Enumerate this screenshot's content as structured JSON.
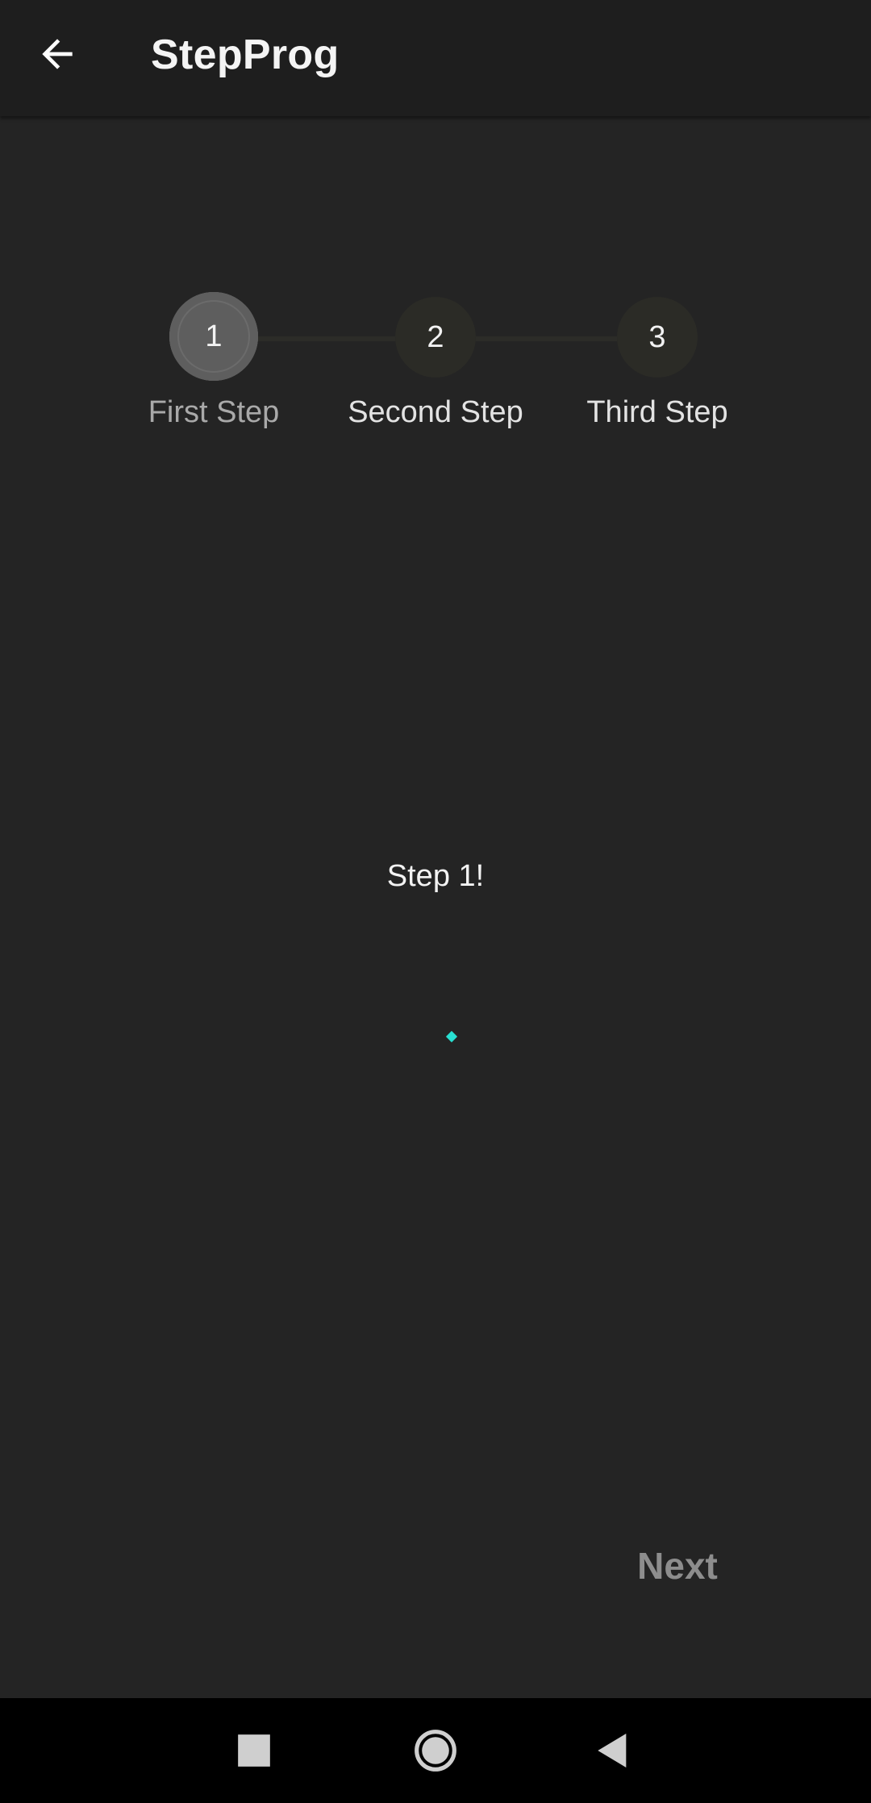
{
  "app_bar": {
    "title": "StepProg",
    "back_icon": "arrow-back-icon"
  },
  "stepper": {
    "active_index": 0,
    "steps": [
      {
        "number": "1",
        "label": "First Step"
      },
      {
        "number": "2",
        "label": "Second Step"
      },
      {
        "number": "3",
        "label": "Third Step"
      }
    ]
  },
  "content": {
    "text": "Step 1!"
  },
  "actions": {
    "next_label": "Next"
  },
  "nav_bar": {
    "recents_icon": "square-icon",
    "home_icon": "circle-icon",
    "back_icon": "triangle-back-icon"
  },
  "colors": {
    "background": "#242424",
    "app_bar": "#1e1e1e",
    "active_step": "#5e5e5e",
    "inactive_step": "#2b2b26",
    "progress_accent": "#28e0d2",
    "next_disabled": "#8d8d8d"
  }
}
